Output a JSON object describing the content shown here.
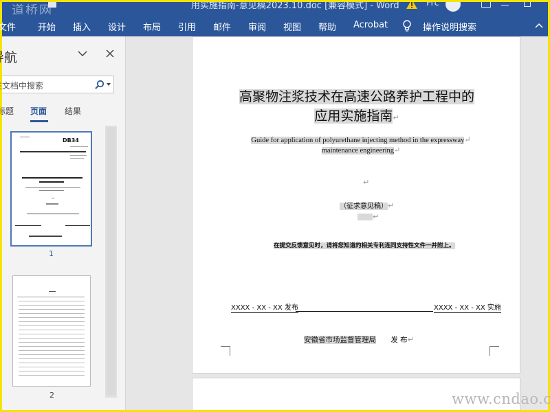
{
  "titlebar": {
    "doc_title": "用实施指南-意见稿2023.10.doc [兼容模式] - Word",
    "user": "Frc",
    "watermark": "道桥网"
  },
  "menubar": {
    "tabs": [
      "文件",
      "开始",
      "插入",
      "设计",
      "布局",
      "引用",
      "邮件",
      "审阅",
      "视图",
      "帮助",
      "Acrobat"
    ],
    "tell_me": "操作说明搜索"
  },
  "navpane": {
    "title": "导航",
    "search_placeholder": "在文档中搜索",
    "tabs": [
      "标题",
      "页面",
      "结果"
    ],
    "active_tab": "页面",
    "page_numbers": [
      "1",
      "2"
    ],
    "thumb1_code": "DB34"
  },
  "document": {
    "title_line1": "高聚物注浆技术在高速公路养护工程中的",
    "title_line2": "应用实施指南",
    "en_line1": "Guide for application of polyurethane injecting method in the expressway",
    "en_line2": "maintenance engineering",
    "draft_label": "（征求意见稿）",
    "notice": "在提交反馈意见时，请将您知道的相关专利连同支持性文件一并附上。",
    "issue_date": "XXXX - XX - XX 发布",
    "impl_date": "XXXX - XX - XX 实施",
    "issuer": "安徽省市场监督管理局",
    "issue_word": "发  布"
  },
  "footer": {
    "watermark_url": "www.cndao.com"
  },
  "colors": {
    "ribbon": "#2b579a",
    "highlight": "#d9d9d9",
    "frame": "#f5e300"
  }
}
